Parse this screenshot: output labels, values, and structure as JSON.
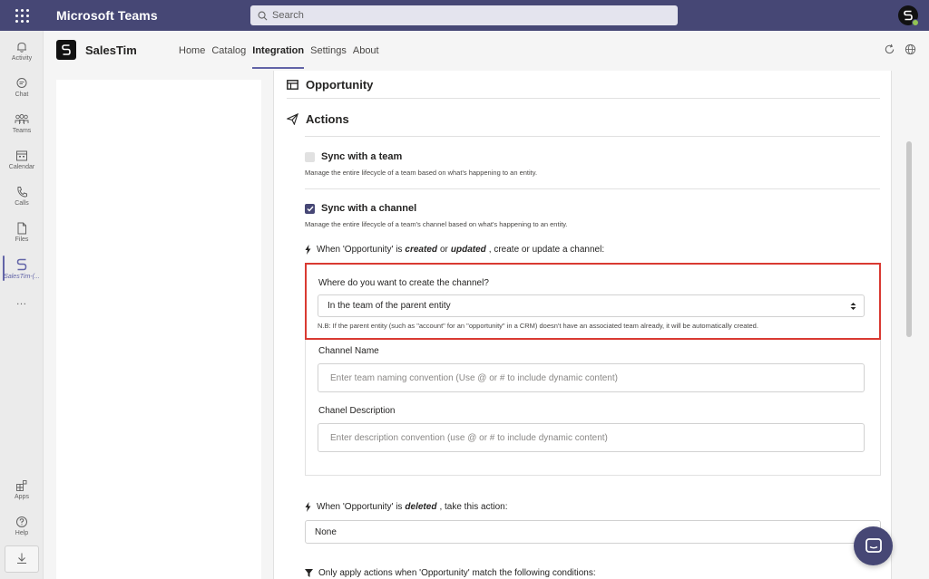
{
  "window": {
    "app_title": "Microsoft Teams",
    "search_placeholder": "Search"
  },
  "rail": {
    "items": [
      {
        "label": "Activity",
        "icon": "bell-icon"
      },
      {
        "label": "Chat",
        "icon": "chat-icon"
      },
      {
        "label": "Teams",
        "icon": "teams-icon"
      },
      {
        "label": "Calendar",
        "icon": "calendar-icon"
      },
      {
        "label": "Calls",
        "icon": "phone-icon"
      },
      {
        "label": "Files",
        "icon": "file-icon"
      },
      {
        "label": "SalesTim-(...",
        "icon": "salestim-icon"
      }
    ],
    "more": "…",
    "apps_label": "Apps",
    "help_label": "Help"
  },
  "app": {
    "name": "SalesTim",
    "nav": [
      "Home",
      "Catalog",
      "Integration",
      "Settings",
      "About"
    ],
    "active_nav": "Integration"
  },
  "main": {
    "entity_title": "Opportunity",
    "actions_title": "Actions",
    "sync_team": {
      "label": "Sync with a team",
      "checked": false,
      "description": "Manage the entire lifecycle of a team based on what's happening to an entity."
    },
    "sync_channel": {
      "label": "Sync with a channel",
      "checked": true,
      "description": "Manage the entire lifecycle of a team's channel based on what's happening to an entity."
    },
    "trigger_create": {
      "prefix": "When 'Opportunity' is",
      "word1": "created",
      "mid": "or",
      "word2": "updated",
      "suffix": ", create or update a channel:"
    },
    "channel_location": {
      "question": "Where do you want to create the channel?",
      "selected": "In the team of the parent entity",
      "note": "N.B: If the parent entity (such as \"account\" for an \"opportunity\" in a CRM) doesn't have an associated team already, it will be automatically created."
    },
    "channel_name": {
      "label": "Channel Name",
      "placeholder": "Enter team naming convention (Use @ or # to include dynamic content)"
    },
    "channel_description": {
      "label": "Chanel Description",
      "placeholder": "Enter description convention (use @ or # to include dynamic content)"
    },
    "trigger_delete": {
      "prefix": "When 'Opportunity' is",
      "word": "deleted",
      "suffix": ", take this action:"
    },
    "delete_action_selected": "None",
    "conditions_text": "Only apply actions when 'Opportunity' match the following conditions:"
  },
  "colors": {
    "teams_purple": "#464775",
    "accent": "#6264a7",
    "highlight_red": "#d93a32"
  }
}
